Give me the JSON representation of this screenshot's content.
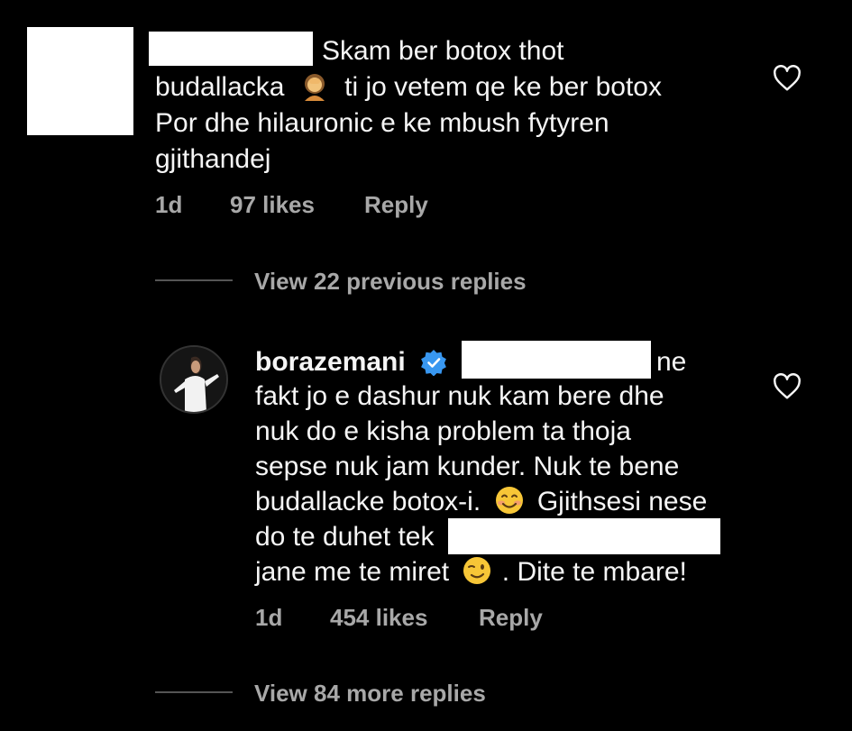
{
  "comment_1": {
    "lines": [
      "Skam ber botox thot",
      "budallacka",
      "ti jo vetem qe ke ber botox",
      "Por dhe hilauronic e ke mbush fytyren",
      "gjithandej"
    ],
    "emoji": "facepalm-woman",
    "meta": {
      "time": "1d",
      "likes": "97 likes",
      "reply": "Reply"
    }
  },
  "replies_toggle_previous": "View 22 previous replies",
  "reply_1": {
    "username": "borazemani",
    "verified": true,
    "lines": [
      "ne",
      "fakt jo e dashur nuk kam bere dhe",
      "nuk do e kisha problem ta thoja",
      "sepse nuk jam kunder. Nuk te bene",
      "budallacke botox-i.",
      "Gjithsesi nese",
      "do te duhet tek",
      "jane me te miret",
      ". Dite te mbare!"
    ],
    "emojis": [
      "smiling-face-icon",
      "winking-face-icon"
    ],
    "meta": {
      "time": "1d",
      "likes": "454 likes",
      "reply": "Reply"
    }
  },
  "replies_toggle_more": "View 84 more replies",
  "colors": {
    "background": "#000000",
    "text": "#f5f5f5",
    "muted": "#a8a8a8",
    "verified": "#3897f0"
  }
}
